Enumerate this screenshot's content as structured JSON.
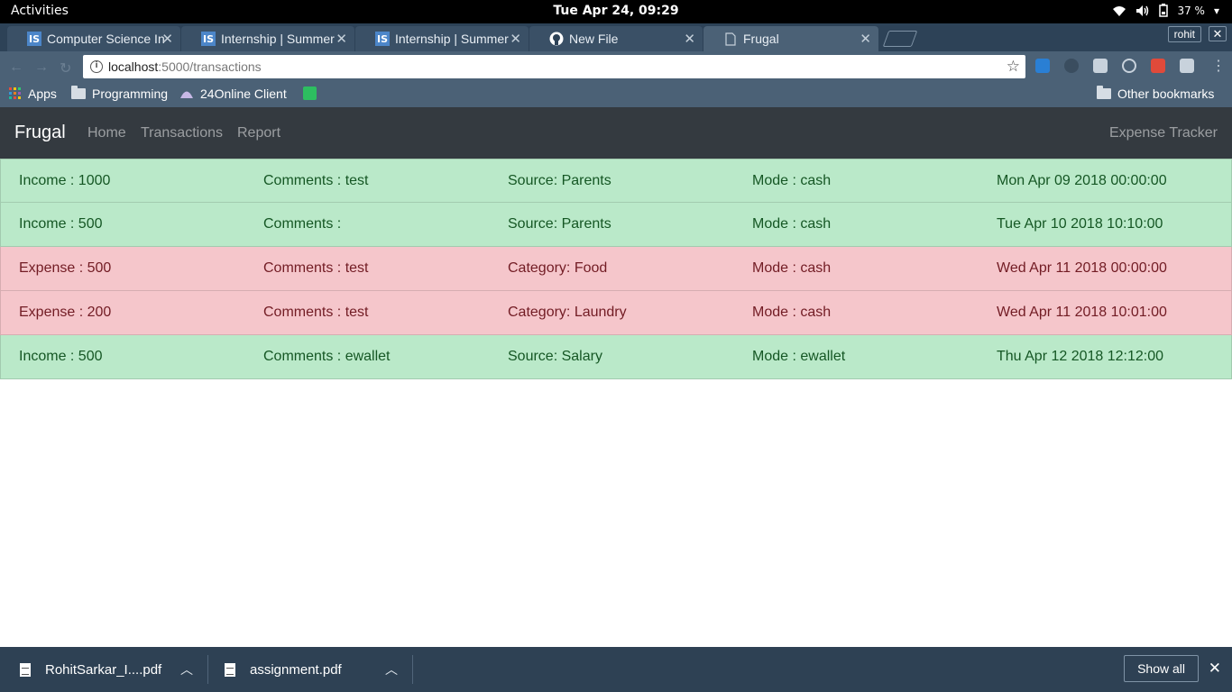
{
  "system": {
    "activities": "Activities",
    "clock": "Tue Apr 24, 09:29",
    "battery": "37 %"
  },
  "browser": {
    "tabs": [
      {
        "title": "Computer Science In",
        "favicon": "IS"
      },
      {
        "title": "Internship | Summer",
        "favicon": "IS"
      },
      {
        "title": "Internship | Summer",
        "favicon": "IS"
      },
      {
        "title": "New File",
        "favicon": "github-icon"
      },
      {
        "title": "Frugal",
        "favicon": "page-icon"
      }
    ],
    "profile": "rohit",
    "url_host": "localhost",
    "url_path": ":5000/transactions",
    "bookmarks": {
      "apps": "Apps",
      "programming": "Programming",
      "client": "24Online Client",
      "other": "Other bookmarks"
    }
  },
  "navbar": {
    "brand": "Frugal",
    "links": [
      "Home",
      "Transactions",
      "Report"
    ],
    "right": "Expense Tracker"
  },
  "transactions": [
    {
      "type": "income",
      "amount": "Income : 1000",
      "comments": "Comments : test",
      "cat": "Source: Parents",
      "mode": "Mode : cash",
      "date": "Mon Apr 09 2018 00:00:00"
    },
    {
      "type": "income",
      "amount": "Income : 500",
      "comments": "Comments :",
      "cat": "Source: Parents",
      "mode": "Mode : cash",
      "date": "Tue Apr 10 2018 10:10:00"
    },
    {
      "type": "expense",
      "amount": "Expense : 500",
      "comments": "Comments : test",
      "cat": "Category: Food",
      "mode": "Mode : cash",
      "date": "Wed Apr 11 2018 00:00:00"
    },
    {
      "type": "expense",
      "amount": "Expense : 200",
      "comments": "Comments : test",
      "cat": "Category: Laundry",
      "mode": "Mode : cash",
      "date": "Wed Apr 11 2018 10:01:00"
    },
    {
      "type": "income",
      "amount": "Income : 500",
      "comments": "Comments : ewallet",
      "cat": "Source: Salary",
      "mode": "Mode : ewallet",
      "date": "Thu Apr 12 2018 12:12:00"
    }
  ],
  "downloads": {
    "files": [
      "RohitSarkar_I....pdf",
      "assignment.pdf"
    ],
    "show_all": "Show all"
  },
  "colors": {
    "income_bg": "#bae9c9",
    "income_text": "#155724",
    "expense_bg": "#f5c6cb",
    "expense_text": "#721c24",
    "navbar_bg": "#343a40"
  }
}
